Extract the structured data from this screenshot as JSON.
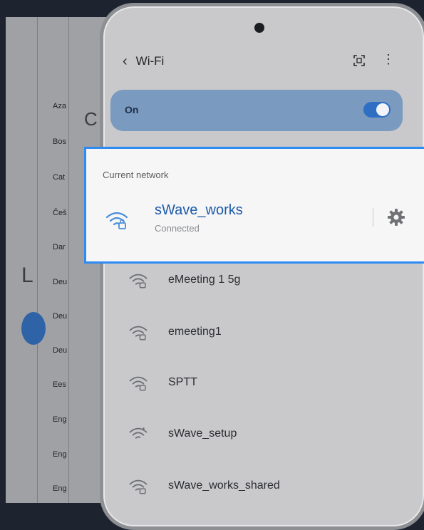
{
  "background": {
    "languages": [
      "Aza",
      "Bos",
      "Cat",
      "Češ",
      "Dar",
      "Deu",
      "Deu",
      "Deu",
      "Ees",
      "Eng",
      "Eng",
      "Eng"
    ],
    "big_letters": [
      "C",
      "L"
    ]
  },
  "header": {
    "title": "Wi-Fi",
    "icons": [
      "back-icon",
      "qr-scan-icon",
      "more-options-icon"
    ]
  },
  "wifi_toggle": {
    "label": "On",
    "state": "on"
  },
  "current_network": {
    "section_label": "Current network",
    "name": "sWave_works",
    "status": "Connected"
  },
  "networks": [
    {
      "name": "eMeeting 1 5g"
    },
    {
      "name": "emeeting1"
    },
    {
      "name": "SPTT"
    },
    {
      "name": "sWave_setup"
    },
    {
      "name": "sWave_works_shared"
    }
  ],
  "colors": {
    "accent": "#2e6fc4",
    "highlight_border": "#2d8bf2",
    "current_name": "#1e5aa8"
  }
}
